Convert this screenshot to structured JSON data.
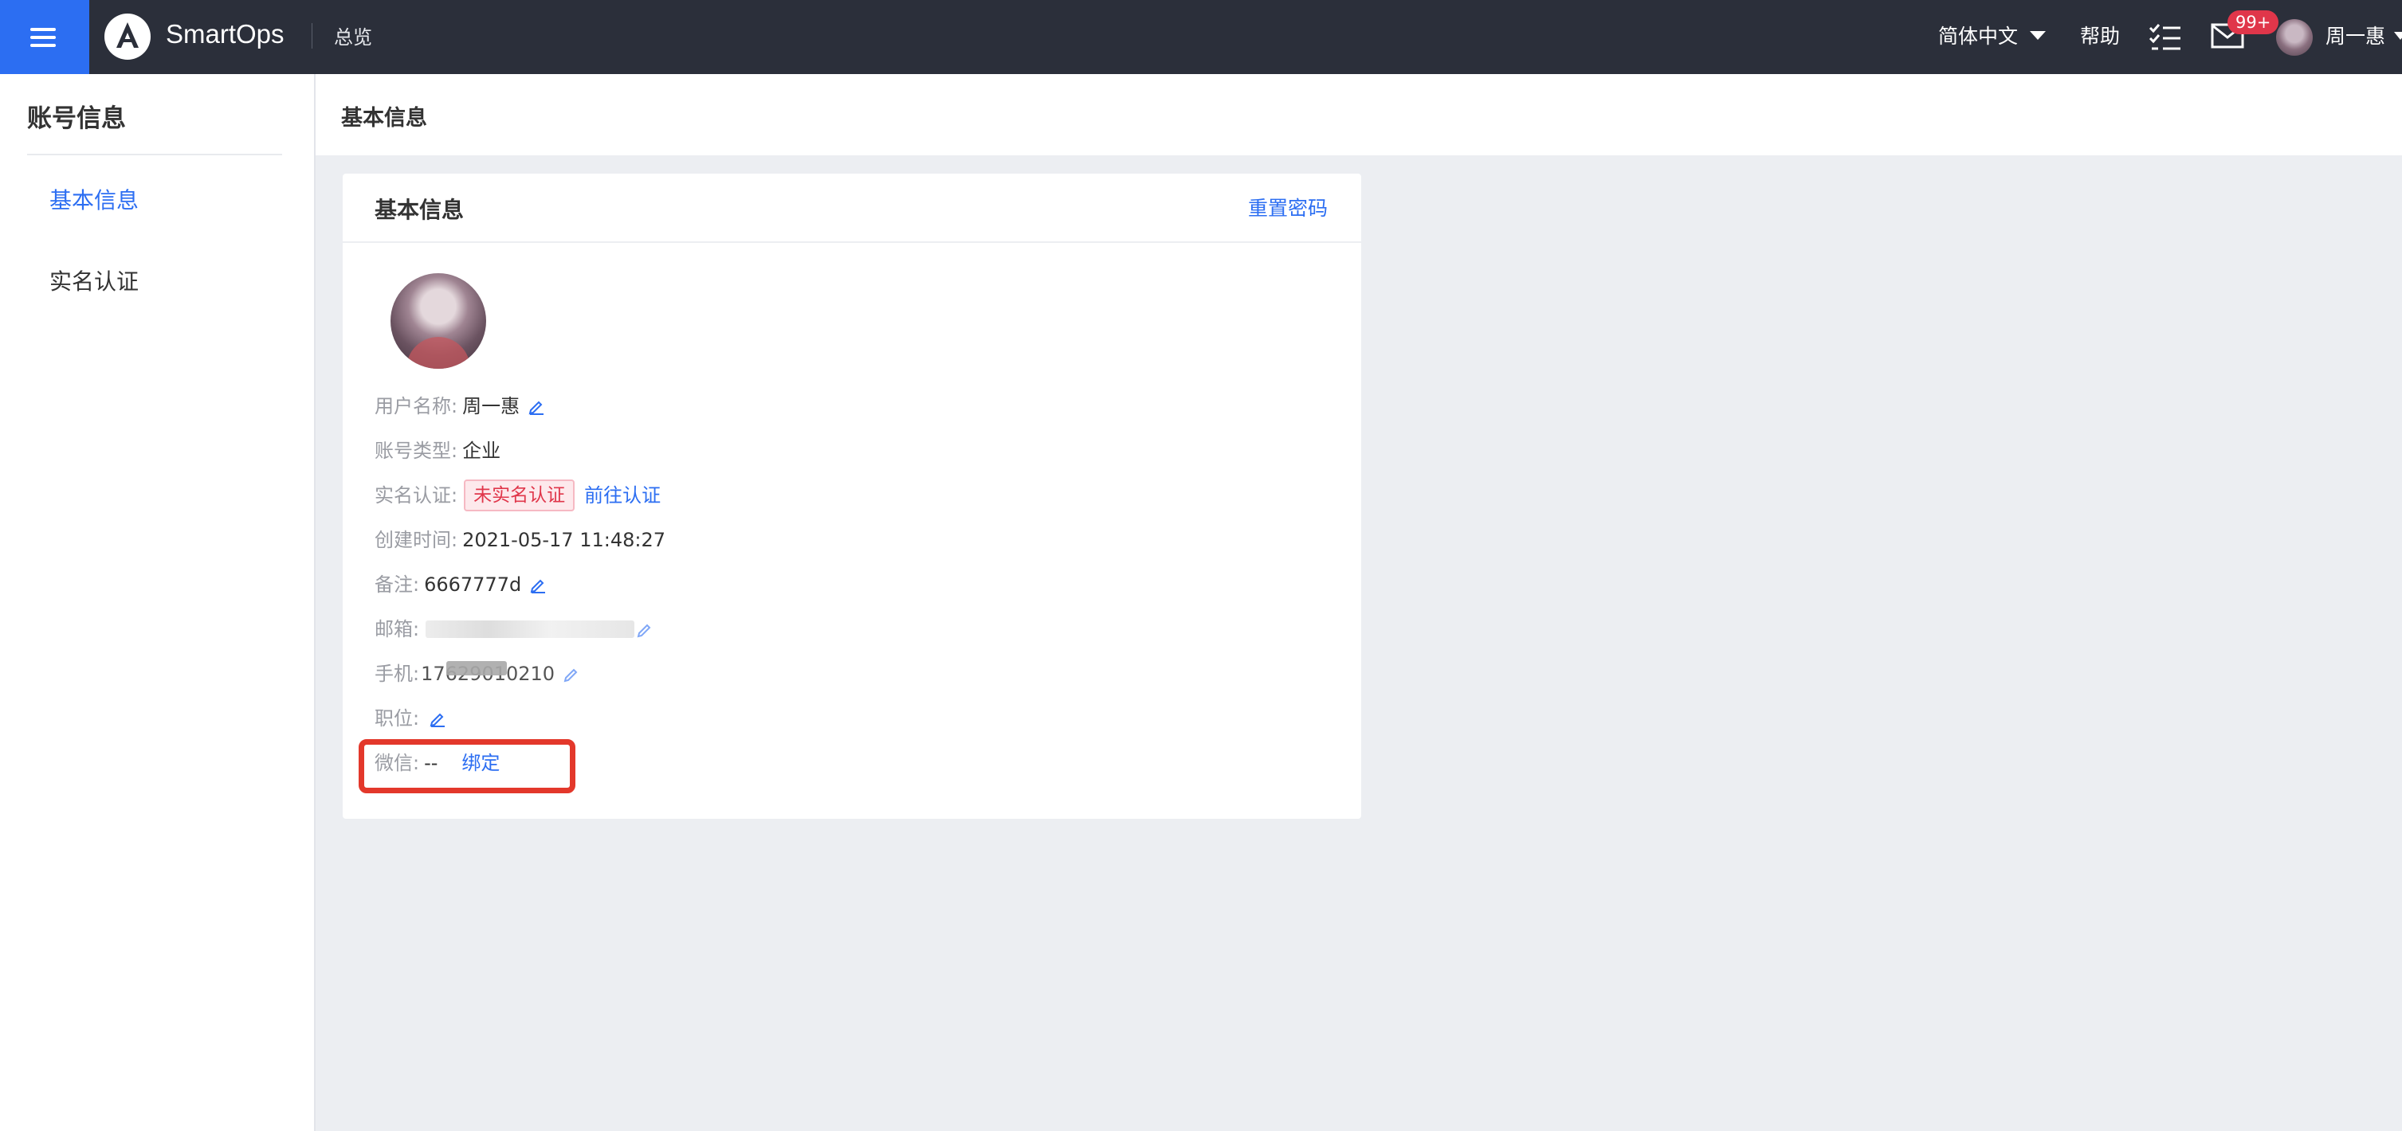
{
  "topbar": {
    "brand": "SmartOps",
    "breadcrumb": "总览",
    "language": "简体中文",
    "help": "帮助",
    "mail_badge": "99+",
    "user_name": "周一惠",
    "icons": [
      "menu-icon",
      "logo-icon",
      "todo-list-icon",
      "mail-icon",
      "avatar",
      "chevron-down-icon"
    ]
  },
  "sidebar": {
    "title": "账号信息",
    "items": [
      {
        "label": "基本信息",
        "active": true
      },
      {
        "label": "实名认证",
        "active": false
      }
    ]
  },
  "main": {
    "header": "基本信息",
    "card": {
      "title": "基本信息",
      "reset_password": "重置密码",
      "fields": {
        "username": {
          "label": "用户名称:",
          "value": "周一惠"
        },
        "account_type": {
          "label": "账号类型:",
          "value": "企业"
        },
        "real_name": {
          "label": "实名认证:",
          "status": "未实名认证",
          "action": "前往认证"
        },
        "created": {
          "label": "创建时间:",
          "value": "2021-05-17 11:48:27"
        },
        "remark": {
          "label": "备注:",
          "value": "6667777d"
        },
        "email": {
          "label": "邮箱:",
          "value": ""
        },
        "phone": {
          "label": "手机:",
          "value": "17629010210"
        },
        "position": {
          "label": "职位:",
          "value": ""
        },
        "wechat": {
          "label": "微信:",
          "value": "--",
          "action": "绑定"
        }
      }
    }
  },
  "colors": {
    "topbar_bg": "#2b2f3a",
    "accent": "#2c6ef2",
    "badge": "#e0364a",
    "highlight_box": "#e3382b",
    "page_bg": "#eceef2"
  }
}
